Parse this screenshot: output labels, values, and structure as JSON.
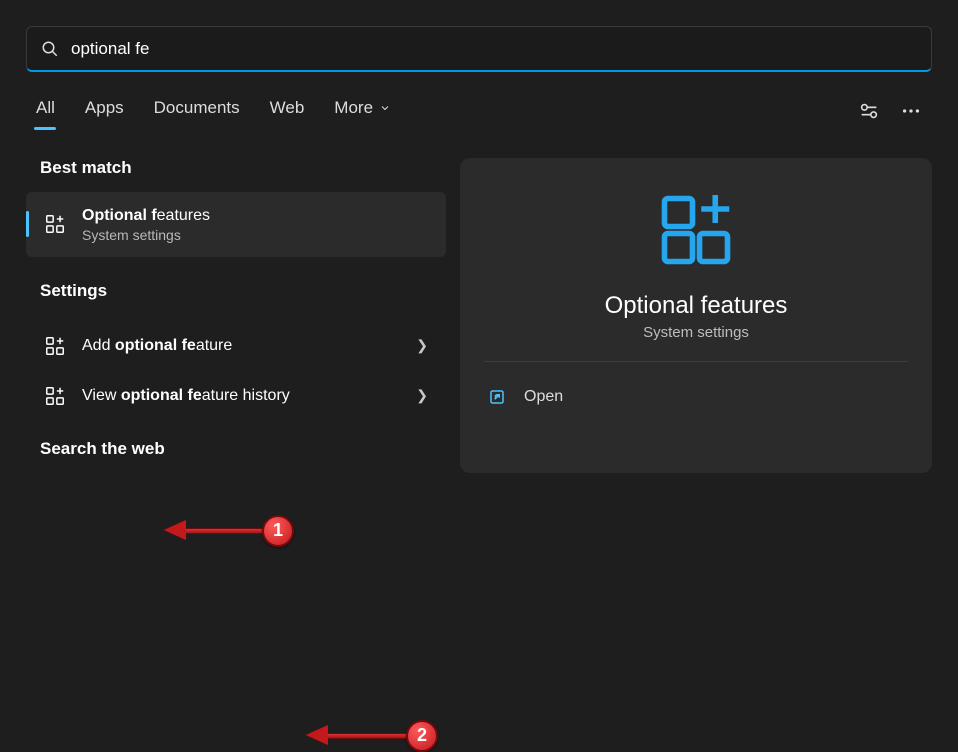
{
  "search": {
    "value": "optional fe"
  },
  "tabs": {
    "items": [
      {
        "label": "All",
        "active": true
      },
      {
        "label": "Apps"
      },
      {
        "label": "Documents"
      },
      {
        "label": "Web"
      },
      {
        "label": "More"
      }
    ]
  },
  "sections": {
    "bestMatch": "Best match",
    "settings": "Settings",
    "searchWeb": "Search the web"
  },
  "result": {
    "title_prefix": "Optional f",
    "title_rest": "eatures",
    "subtitle": "System settings"
  },
  "settingsItems": [
    {
      "pre": "Add ",
      "bold": "optional fe",
      "post": "ature"
    },
    {
      "pre": "View ",
      "bold": "optional fe",
      "post": "ature history"
    }
  ],
  "detail": {
    "title": "Optional features",
    "subtitle": "System settings",
    "open": "Open"
  },
  "callouts": {
    "one": "1",
    "two": "2"
  },
  "colors": {
    "accent": "#4cc2ff"
  }
}
